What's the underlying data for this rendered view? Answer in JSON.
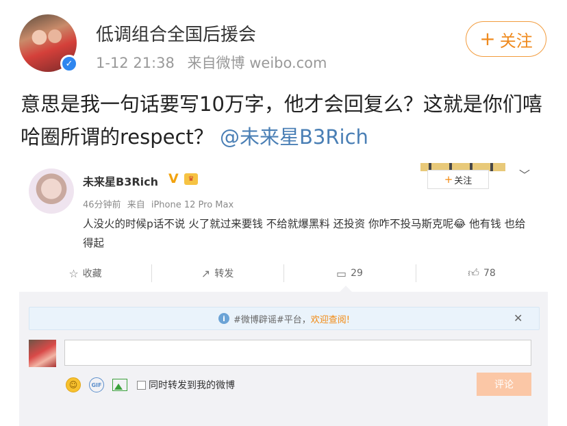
{
  "post": {
    "author": "低调组合全国后援会",
    "time": "1-12 21:38",
    "source": "来自微博 weibo.com",
    "follow_label": "关注",
    "text": "意思是我一句话要写10万字，他才会回复么？这就是你们嘻哈圈所谓的respect？",
    "mention": "@未来星B3Rich"
  },
  "embedded": {
    "author": "未来星B3Rich",
    "verified_mark": "V",
    "time": "46分钟前",
    "source_prefix": "来自",
    "source_device": "iPhone 12 Pro Max",
    "follow_label": "关注",
    "text": "人没火的时候p话不说 火了就过来要钱 不给就爆黑料 还投资 你咋不投马斯克呢😂 他有钱 也给得起",
    "actions": {
      "favorite": "收藏",
      "repost": "转发",
      "comment_count": "29",
      "like_count": "78"
    },
    "notice": {
      "prefix": "#微博辟谣#平台，",
      "link": "欢迎查阅!"
    },
    "comment_box": {
      "placeholder": "",
      "repost_checkbox_label": "同时转发到我的微博",
      "submit_label": "评论"
    }
  },
  "icons": {
    "verify": "verified-badge-icon",
    "close": "close-icon",
    "info": "info-icon",
    "favorite": "star-icon",
    "repost": "share-icon",
    "comment": "comment-icon",
    "like": "thumbs-up-icon",
    "chevron": "chevron-down-icon"
  },
  "colors": {
    "accent_orange": "#ef8a1e",
    "mention_blue": "#4a7fb5",
    "verify_blue": "#2f86ef"
  }
}
